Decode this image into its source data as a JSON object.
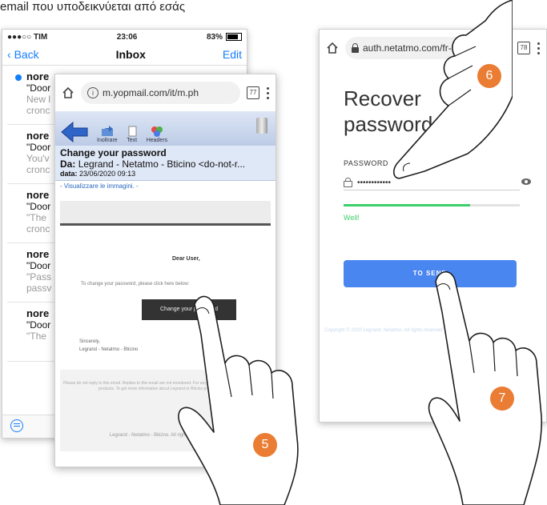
{
  "caption": "email που υποδεικνύεται από εσάς",
  "phone1": {
    "status": {
      "carrier": "●●●○○ TIM",
      "time": "23:06",
      "battery": "83%"
    },
    "nav": {
      "back": "Back",
      "title": "Inbox",
      "edit": "Edit"
    },
    "mails": [
      {
        "from": "nore",
        "subject": "\"Door",
        "preview": "New l",
        "preview2": "cronc",
        "unread": true
      },
      {
        "from": "nore",
        "subject": "\"Door",
        "preview": "You'v",
        "preview2": "cronc",
        "unread": false
      },
      {
        "from": "nore",
        "subject": "\"Door",
        "preview": "\"The",
        "preview2": "cronc",
        "unread": false
      },
      {
        "from": "nore",
        "subject": "\"Door",
        "preview": "\"Pass",
        "preview2": "passv",
        "unread": false
      },
      {
        "from": "nore",
        "subject": "\"Door",
        "preview": "\"The",
        "preview2": "",
        "unread": false
      }
    ]
  },
  "phone2": {
    "url": "m.yopmail.com/it/m.ph",
    "tabs": "77",
    "toolbar": {
      "forward": "Inoltrare",
      "text": "Text",
      "headers": "Headers"
    },
    "subject": "Change your password",
    "from_label": "Da:",
    "from": "Legrand - Netatmo - Bticino <do-not-r...",
    "date_label": "data:",
    "date": "23/06/2020 09:13",
    "show_images": "- Visualizzare le immagini. -",
    "greeting": "Dear User,",
    "instruction": "To change your password, please click here below:",
    "button": "Change your password",
    "sincerely": "Sincerely,",
    "signature": "Legrand - Netatmo - Bticino",
    "footer_text": "Please do not reply to this email. Replies to this email are not monitored. For any further information about Netatmo products. To get more information about Legrand or Bticino products search",
    "footer_copy": "Legrand - Netatmo - Bticino. All rights reserved 2020"
  },
  "phone3": {
    "url": "auth.netatmo.com/fr-fr",
    "tabs": "78",
    "title_line1": "Recover",
    "title_line2": "password",
    "label": "PASSWORD",
    "password": "••••••••••••",
    "strength_fraction": 0.72,
    "strength_text": "Well!",
    "button": "TO SEND",
    "copyright": "Copyright © 2020 Legrand, Netatmo. All rights reserved"
  },
  "steps": [
    "5",
    "6",
    "7"
  ],
  "colors": {
    "ios_blue": "#157efb",
    "step_orange": "#ea7d33",
    "send_blue": "#4a86f0",
    "strength_green": "#3ccf6a"
  }
}
